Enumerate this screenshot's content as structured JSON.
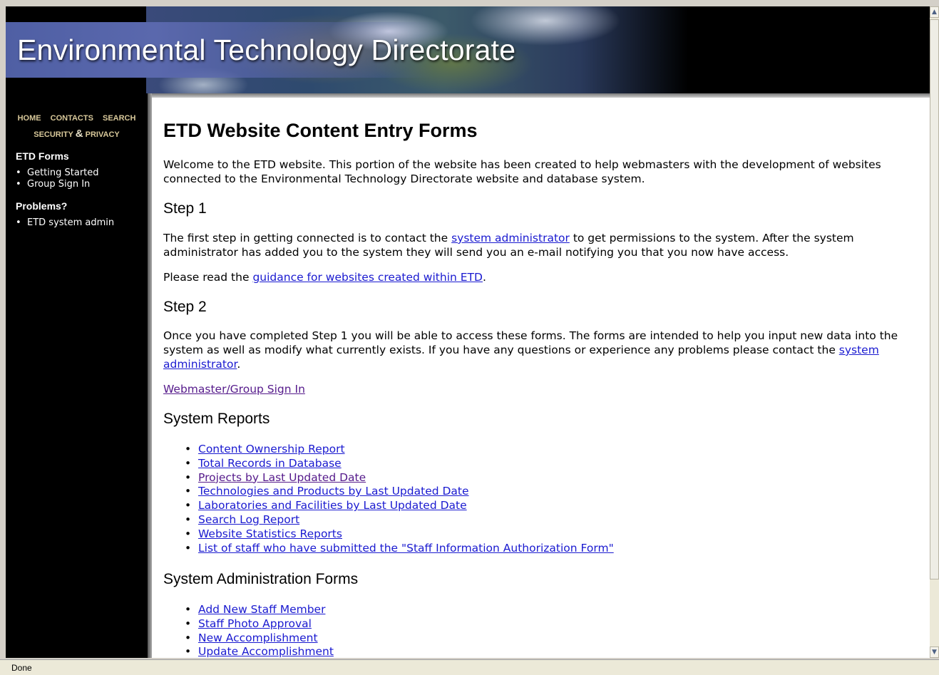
{
  "banner": {
    "title": "Environmental Technology Directorate"
  },
  "sidebar": {
    "nav": {
      "home": "HOME",
      "contacts": "CONTACTS",
      "search": "SEARCH",
      "security": "SECURITY",
      "amp": "&",
      "privacy": "PRIVACY"
    },
    "sections": [
      {
        "heading": "ETD Forms",
        "items": [
          "Getting Started",
          "Group Sign In"
        ]
      },
      {
        "heading": "Problems?",
        "items": [
          "ETD system admin"
        ]
      }
    ]
  },
  "main": {
    "title": "ETD Website Content Entry Forms",
    "intro": "Welcome to the ETD website. This portion of the website has been created to help webmasters with the development of websites connected to the Environmental Technology Directorate website and database system.",
    "step1": {
      "heading": "Step 1",
      "p1_before": "The first step in getting connected is to contact the ",
      "p1_link": "system administrator",
      "p1_after": " to get permissions to the system. After the system administrator has added you to the system they will send you an e-mail notifying you that you now have access.",
      "p2_before": "Please read the ",
      "p2_link": "guidance for websites created within ETD",
      "p2_after": "."
    },
    "step2": {
      "heading": "Step 2",
      "p_before": "Once you have completed Step 1 you will be able to access these forms. The forms are intended to help you input new data into the system as well as modify what currently exists. If you have any questions or experience any problems please contact the ",
      "p_link": "system administrator",
      "p_after": ".",
      "signin_link": "Webmaster/Group Sign In"
    },
    "reports": {
      "heading": "System Reports",
      "items": [
        "Content Ownership Report",
        "Total Records in Database",
        "Projects by Last Updated Date",
        "Technologies and Products by Last Updated Date",
        "Laboratories and Facilities by Last Updated Date",
        "Search Log Report",
        "Website Statistics Reports",
        "List of staff who have submitted the \"Staff Information Authorization Form\""
      ]
    },
    "admin": {
      "heading": "System Administration Forms",
      "items": [
        "Add New Staff Member",
        "Staff Photo Approval",
        "New Accomplishment",
        "Update Accomplishment"
      ]
    }
  },
  "status": {
    "text": "Done"
  },
  "colors": {
    "link": "#1a1ad0",
    "visited": "#551a8b",
    "nav_text": "#d8c89a",
    "banner_blue": "#5a68ad"
  }
}
